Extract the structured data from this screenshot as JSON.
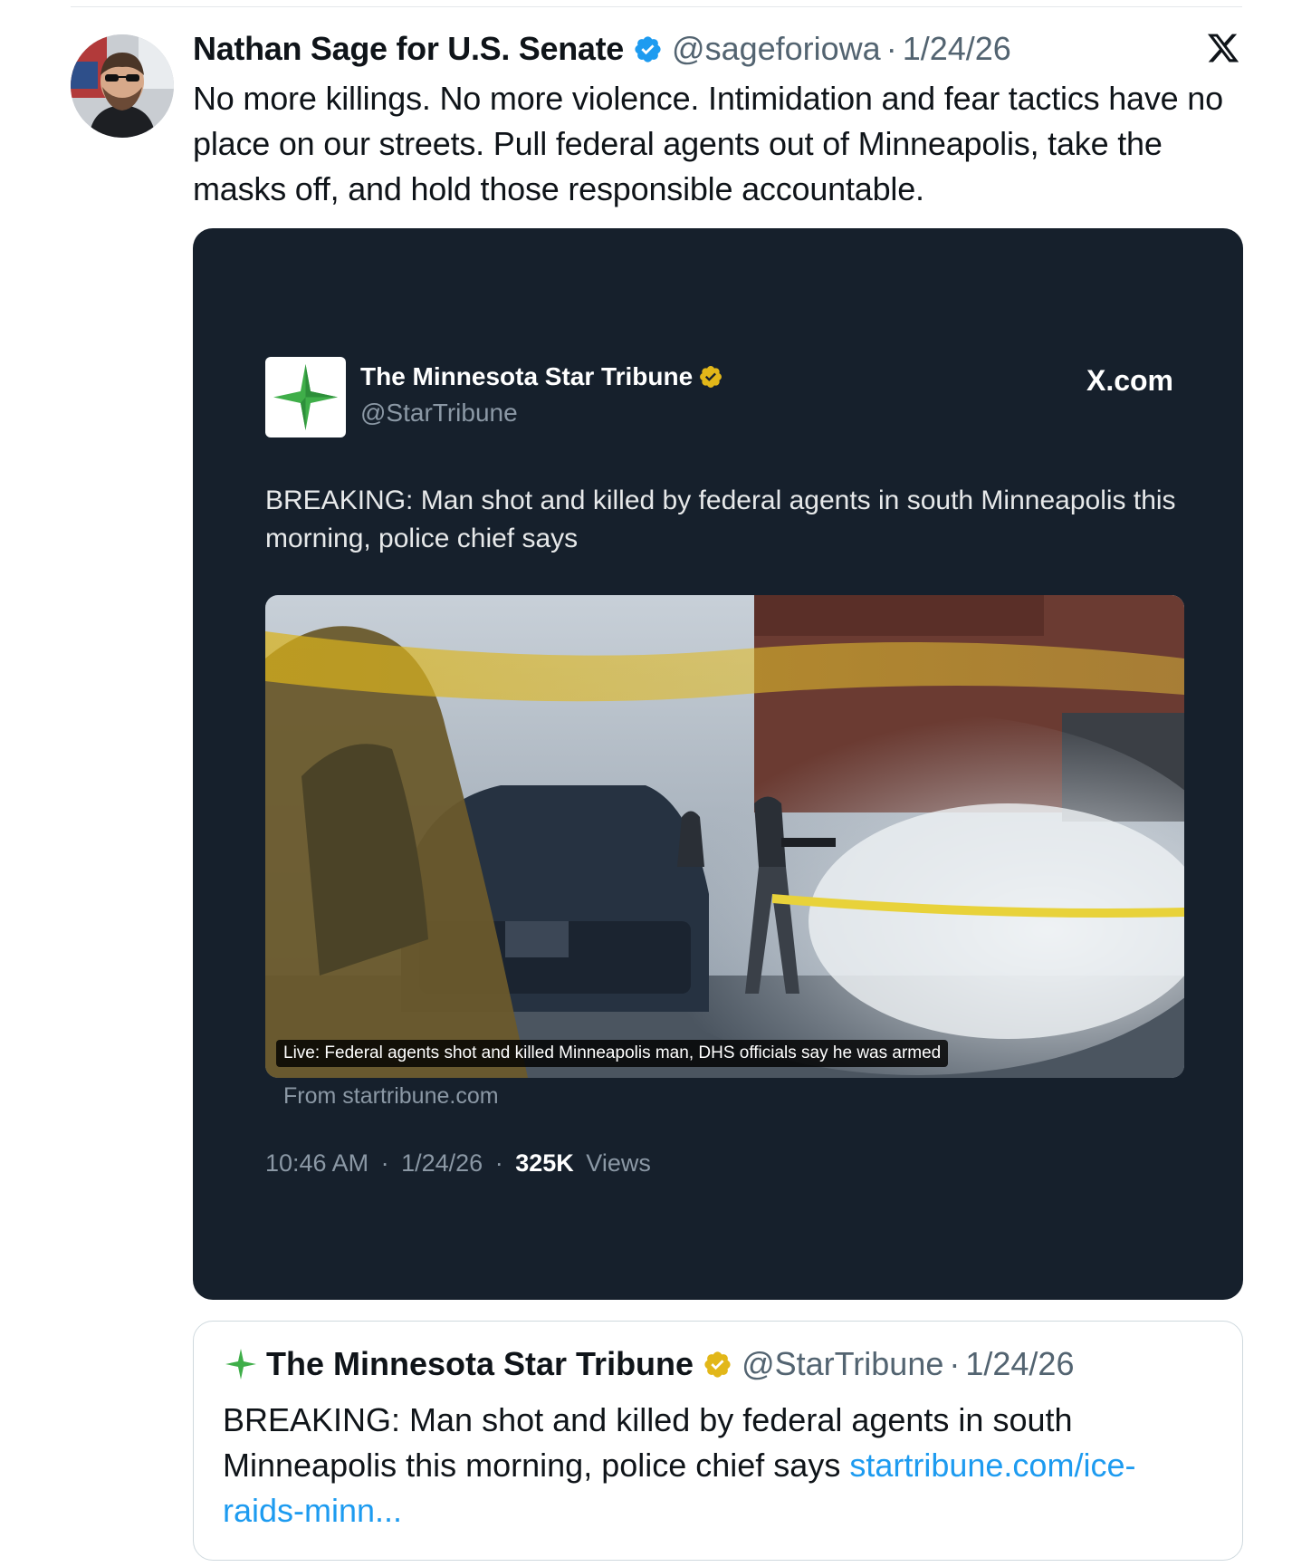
{
  "tweet": {
    "author_name": "Nathan Sage for U.S. Senate",
    "handle": "@sageforiowa",
    "separator": "·",
    "date": "1/24/26",
    "text": "No more killings. No more violence. Intimidation and fear tactics have no place on our streets. Pull federal agents out of Minneapolis, take the masks off, and hold those responsible accountable.",
    "verified_color": "#1d9bf0"
  },
  "embedded": {
    "account_name": "The Minnesota Star Tribune",
    "account_handle": "@StarTribune",
    "site_label": "X.com",
    "text": "BREAKING: Man shot and killed by federal agents in south Minneapolis this morning, police chief says",
    "photo_caption": "Live: Federal agents shot and killed Minneapolis man, DHS officials say he was armed",
    "source": "From startribune.com",
    "time": "10:46 AM",
    "separator": "·",
    "date": "1/24/26",
    "views_count": "325K",
    "views_label": "Views",
    "background": "#16202c",
    "badge_color": "#e2b719"
  },
  "quote": {
    "account_name": "The Minnesota Star Tribune",
    "handle": "@StarTribune",
    "separator": "·",
    "date": "1/24/26",
    "text": "BREAKING: Man shot and killed by federal agents in south Minneapolis this morning, police chief says ",
    "link": "startribune.com/ice-raids-minn...",
    "link_color": "#1d9bf0"
  },
  "icons": {
    "verified": "verified-badge-icon",
    "gold_verified": "gold-verified-badge-icon",
    "x_logo": "x-logo-icon",
    "star_logo": "star-tribune-logo-icon"
  }
}
